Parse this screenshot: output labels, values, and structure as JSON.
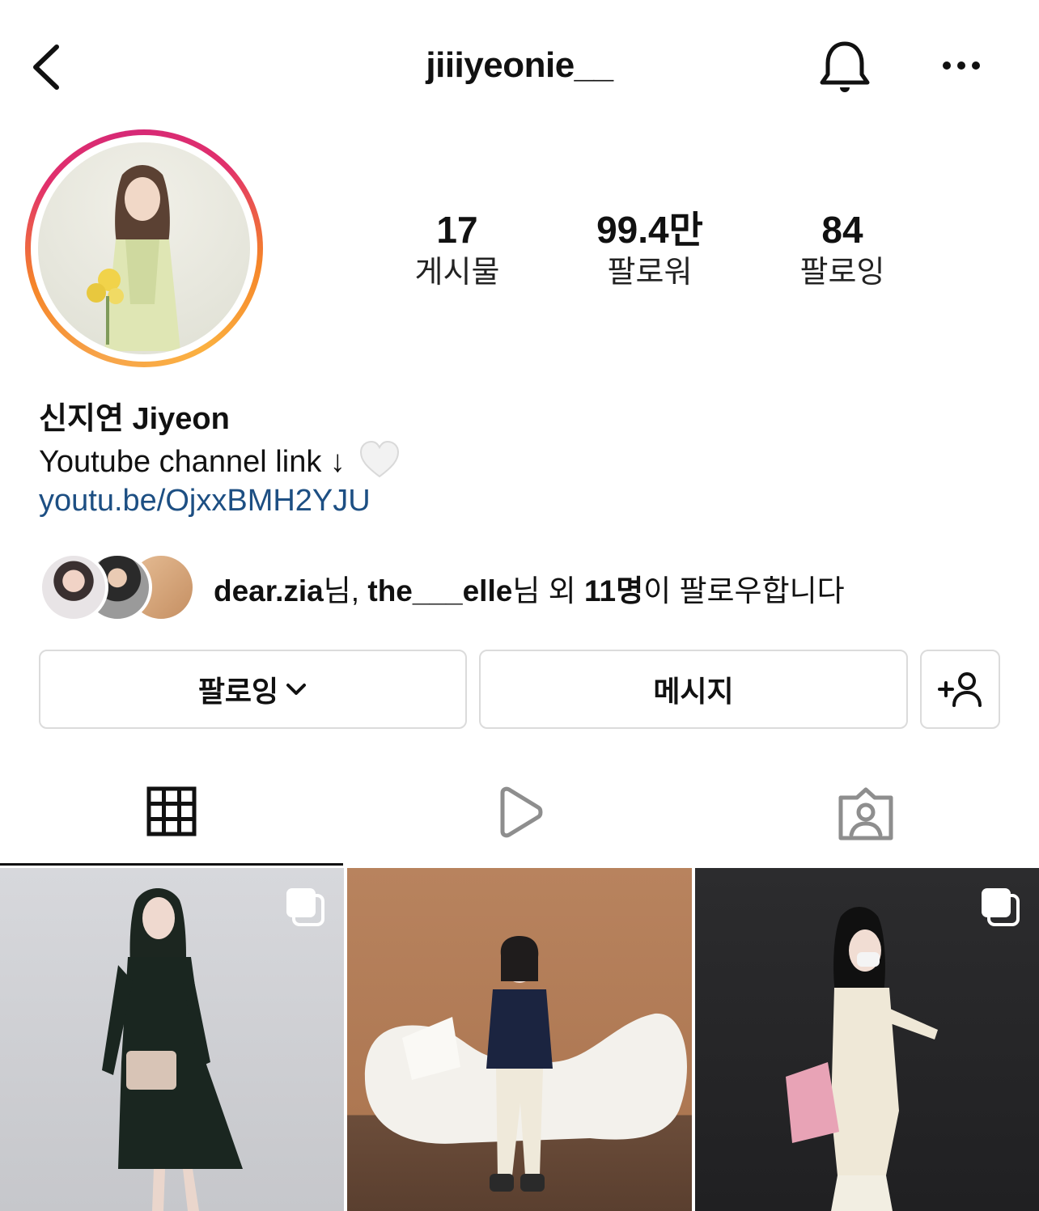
{
  "header": {
    "username": "jiiiyeonie__",
    "back_icon": "chevron-left-icon",
    "bell_icon": "bell-icon",
    "more_icon": "ellipsis-icon"
  },
  "stats": {
    "posts": {
      "value": "17",
      "label": "게시물"
    },
    "followers": {
      "value": "99.4만",
      "label": "팔로워"
    },
    "following": {
      "value": "84",
      "label": "팔로잉"
    }
  },
  "bio": {
    "name": "신지연 Jiyeon",
    "text": "Youtube channel link ↓",
    "link": "youtu.be/OjxxBMH2YJU"
  },
  "followed_by": {
    "user1": "dear.zia",
    "suffix1": "님, ",
    "user2": "the___elle",
    "suffix2": "님 외 ",
    "count": "11명",
    "suffix3": "이 팔로우합니다"
  },
  "actions": {
    "follow_label": "팔로잉",
    "message_label": "메시지"
  },
  "tabs": [
    "grid-icon",
    "reels-icon",
    "tagged-icon"
  ],
  "colors": {
    "link": "#1d4f83",
    "border": "#dbdbdb"
  }
}
